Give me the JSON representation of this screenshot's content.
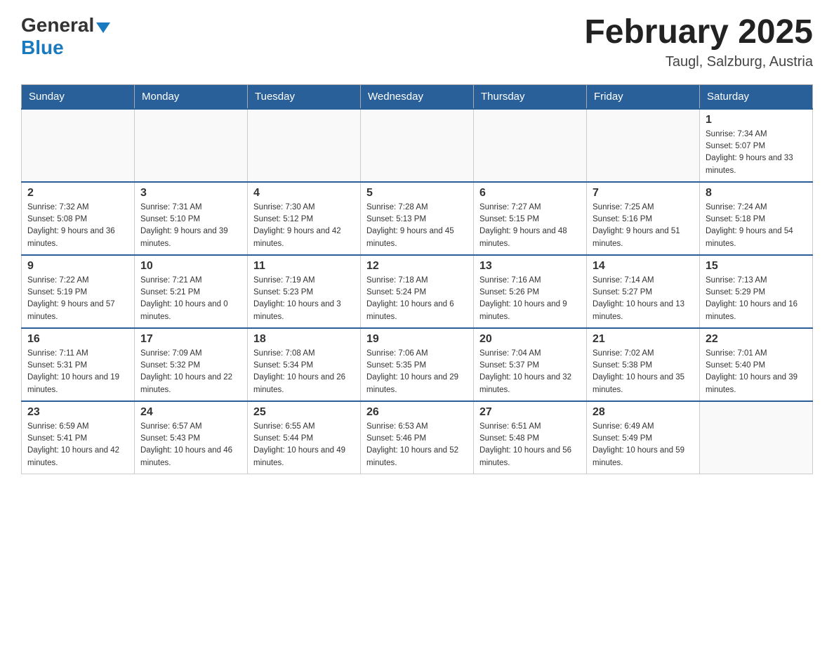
{
  "header": {
    "logo_general": "General",
    "logo_blue": "Blue",
    "title": "February 2025",
    "subtitle": "Taugl, Salzburg, Austria"
  },
  "days_of_week": [
    "Sunday",
    "Monday",
    "Tuesday",
    "Wednesday",
    "Thursday",
    "Friday",
    "Saturday"
  ],
  "weeks": [
    [
      {
        "day": "",
        "sunrise": "",
        "sunset": "",
        "daylight": ""
      },
      {
        "day": "",
        "sunrise": "",
        "sunset": "",
        "daylight": ""
      },
      {
        "day": "",
        "sunrise": "",
        "sunset": "",
        "daylight": ""
      },
      {
        "day": "",
        "sunrise": "",
        "sunset": "",
        "daylight": ""
      },
      {
        "day": "",
        "sunrise": "",
        "sunset": "",
        "daylight": ""
      },
      {
        "day": "",
        "sunrise": "",
        "sunset": "",
        "daylight": ""
      },
      {
        "day": "1",
        "sunrise": "Sunrise: 7:34 AM",
        "sunset": "Sunset: 5:07 PM",
        "daylight": "Daylight: 9 hours and 33 minutes."
      }
    ],
    [
      {
        "day": "2",
        "sunrise": "Sunrise: 7:32 AM",
        "sunset": "Sunset: 5:08 PM",
        "daylight": "Daylight: 9 hours and 36 minutes."
      },
      {
        "day": "3",
        "sunrise": "Sunrise: 7:31 AM",
        "sunset": "Sunset: 5:10 PM",
        "daylight": "Daylight: 9 hours and 39 minutes."
      },
      {
        "day": "4",
        "sunrise": "Sunrise: 7:30 AM",
        "sunset": "Sunset: 5:12 PM",
        "daylight": "Daylight: 9 hours and 42 minutes."
      },
      {
        "day": "5",
        "sunrise": "Sunrise: 7:28 AM",
        "sunset": "Sunset: 5:13 PM",
        "daylight": "Daylight: 9 hours and 45 minutes."
      },
      {
        "day": "6",
        "sunrise": "Sunrise: 7:27 AM",
        "sunset": "Sunset: 5:15 PM",
        "daylight": "Daylight: 9 hours and 48 minutes."
      },
      {
        "day": "7",
        "sunrise": "Sunrise: 7:25 AM",
        "sunset": "Sunset: 5:16 PM",
        "daylight": "Daylight: 9 hours and 51 minutes."
      },
      {
        "day": "8",
        "sunrise": "Sunrise: 7:24 AM",
        "sunset": "Sunset: 5:18 PM",
        "daylight": "Daylight: 9 hours and 54 minutes."
      }
    ],
    [
      {
        "day": "9",
        "sunrise": "Sunrise: 7:22 AM",
        "sunset": "Sunset: 5:19 PM",
        "daylight": "Daylight: 9 hours and 57 minutes."
      },
      {
        "day": "10",
        "sunrise": "Sunrise: 7:21 AM",
        "sunset": "Sunset: 5:21 PM",
        "daylight": "Daylight: 10 hours and 0 minutes."
      },
      {
        "day": "11",
        "sunrise": "Sunrise: 7:19 AM",
        "sunset": "Sunset: 5:23 PM",
        "daylight": "Daylight: 10 hours and 3 minutes."
      },
      {
        "day": "12",
        "sunrise": "Sunrise: 7:18 AM",
        "sunset": "Sunset: 5:24 PM",
        "daylight": "Daylight: 10 hours and 6 minutes."
      },
      {
        "day": "13",
        "sunrise": "Sunrise: 7:16 AM",
        "sunset": "Sunset: 5:26 PM",
        "daylight": "Daylight: 10 hours and 9 minutes."
      },
      {
        "day": "14",
        "sunrise": "Sunrise: 7:14 AM",
        "sunset": "Sunset: 5:27 PM",
        "daylight": "Daylight: 10 hours and 13 minutes."
      },
      {
        "day": "15",
        "sunrise": "Sunrise: 7:13 AM",
        "sunset": "Sunset: 5:29 PM",
        "daylight": "Daylight: 10 hours and 16 minutes."
      }
    ],
    [
      {
        "day": "16",
        "sunrise": "Sunrise: 7:11 AM",
        "sunset": "Sunset: 5:31 PM",
        "daylight": "Daylight: 10 hours and 19 minutes."
      },
      {
        "day": "17",
        "sunrise": "Sunrise: 7:09 AM",
        "sunset": "Sunset: 5:32 PM",
        "daylight": "Daylight: 10 hours and 22 minutes."
      },
      {
        "day": "18",
        "sunrise": "Sunrise: 7:08 AM",
        "sunset": "Sunset: 5:34 PM",
        "daylight": "Daylight: 10 hours and 26 minutes."
      },
      {
        "day": "19",
        "sunrise": "Sunrise: 7:06 AM",
        "sunset": "Sunset: 5:35 PM",
        "daylight": "Daylight: 10 hours and 29 minutes."
      },
      {
        "day": "20",
        "sunrise": "Sunrise: 7:04 AM",
        "sunset": "Sunset: 5:37 PM",
        "daylight": "Daylight: 10 hours and 32 minutes."
      },
      {
        "day": "21",
        "sunrise": "Sunrise: 7:02 AM",
        "sunset": "Sunset: 5:38 PM",
        "daylight": "Daylight: 10 hours and 35 minutes."
      },
      {
        "day": "22",
        "sunrise": "Sunrise: 7:01 AM",
        "sunset": "Sunset: 5:40 PM",
        "daylight": "Daylight: 10 hours and 39 minutes."
      }
    ],
    [
      {
        "day": "23",
        "sunrise": "Sunrise: 6:59 AM",
        "sunset": "Sunset: 5:41 PM",
        "daylight": "Daylight: 10 hours and 42 minutes."
      },
      {
        "day": "24",
        "sunrise": "Sunrise: 6:57 AM",
        "sunset": "Sunset: 5:43 PM",
        "daylight": "Daylight: 10 hours and 46 minutes."
      },
      {
        "day": "25",
        "sunrise": "Sunrise: 6:55 AM",
        "sunset": "Sunset: 5:44 PM",
        "daylight": "Daylight: 10 hours and 49 minutes."
      },
      {
        "day": "26",
        "sunrise": "Sunrise: 6:53 AM",
        "sunset": "Sunset: 5:46 PM",
        "daylight": "Daylight: 10 hours and 52 minutes."
      },
      {
        "day": "27",
        "sunrise": "Sunrise: 6:51 AM",
        "sunset": "Sunset: 5:48 PM",
        "daylight": "Daylight: 10 hours and 56 minutes."
      },
      {
        "day": "28",
        "sunrise": "Sunrise: 6:49 AM",
        "sunset": "Sunset: 5:49 PM",
        "daylight": "Daylight: 10 hours and 59 minutes."
      },
      {
        "day": "",
        "sunrise": "",
        "sunset": "",
        "daylight": ""
      }
    ]
  ]
}
